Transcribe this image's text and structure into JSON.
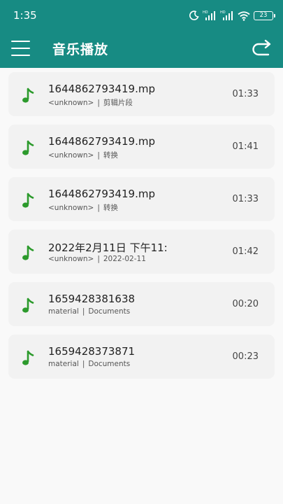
{
  "status_bar": {
    "time": "1:35",
    "battery": "23",
    "icons": [
      "moon-icon",
      "hd-signal-icon",
      "hd-signal-icon",
      "wifi-icon",
      "battery-icon"
    ]
  },
  "header": {
    "title": "音乐播放",
    "menu_icon": "hamburger-menu-icon",
    "refresh_icon": "refresh-icon",
    "background_color": "#178b83"
  },
  "tracks": [
    {
      "title": "1644862793419.mp",
      "artist": "<unknown>",
      "album": "剪辑片段",
      "duration": "01:33"
    },
    {
      "title": "1644862793419.mp",
      "artist": "<unknown>",
      "album": "转换",
      "duration": "01:41"
    },
    {
      "title": "1644862793419.mp",
      "artist": "<unknown>",
      "album": "转换",
      "duration": "01:33"
    },
    {
      "title": "2022年2月11日 下午11:",
      "artist": "<unknown>",
      "album": "2022-02-11",
      "duration": "01:42"
    },
    {
      "title": "1659428381638",
      "artist": "material",
      "album": "Documents",
      "duration": "00:20"
    },
    {
      "title": "1659428373871",
      "artist": "material",
      "album": "Documents",
      "duration": "00:23"
    }
  ],
  "separator": "|",
  "note_icon": "music-note-icon",
  "note_color": "#2c9a2c"
}
